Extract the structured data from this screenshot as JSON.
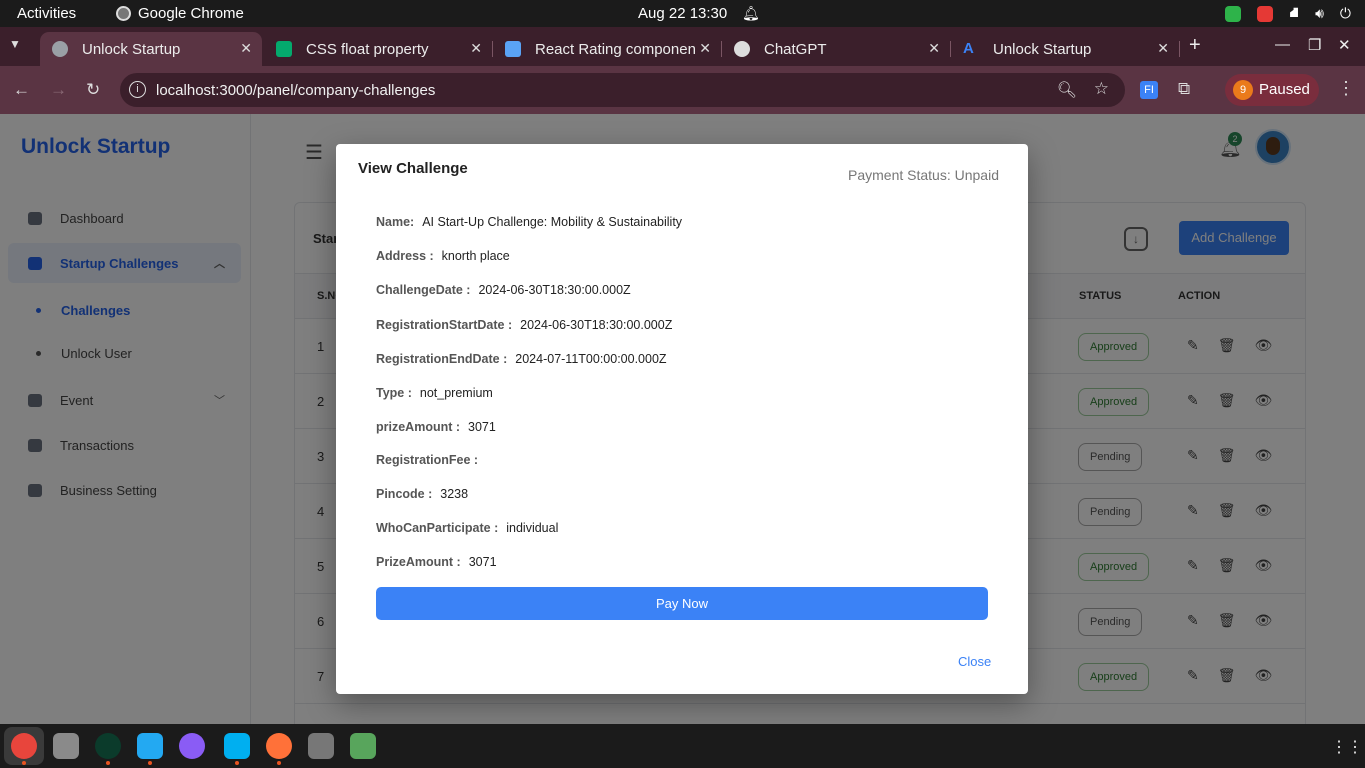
{
  "system": {
    "activities": "Activities",
    "app_name": "Google Chrome",
    "clock": "Aug 22  13:30"
  },
  "browser": {
    "tabs": [
      {
        "title": "Unlock Startup",
        "favicon": "globe-icon",
        "color": "#9aa0a6"
      },
      {
        "title": "CSS float property",
        "favicon": "w3schools-icon",
        "color": "#04aa6d"
      },
      {
        "title": "React Rating componen",
        "favicon": "mui-icon",
        "color": "#5aa3f5"
      },
      {
        "title": "ChatGPT",
        "favicon": "openai-icon",
        "color": "#dddddd"
      },
      {
        "title": "Unlock Startup",
        "favicon": "a-logo-icon",
        "color": "#3b82f6"
      }
    ],
    "url": "localhost:3000/panel/company-challenges",
    "profile_initial": "9",
    "profile_status": "Paused",
    "extension_label": "FI"
  },
  "app": {
    "brand": "Unlock Startup",
    "sidebar": {
      "items": [
        {
          "label": "Dashboard",
          "icon": "dashboard-icon"
        },
        {
          "label": "Startup Challenges",
          "icon": "challenges-icon",
          "expanded": true
        },
        {
          "label": "Event",
          "icon": "calendar-icon"
        },
        {
          "label": "Transactions",
          "icon": "wallet-icon"
        },
        {
          "label": "Business Setting",
          "icon": "settings-icon"
        }
      ],
      "sub_items": [
        {
          "label": "Challenges",
          "active": true
        },
        {
          "label": "Unlock User",
          "active": false
        }
      ]
    },
    "notification_count": "2",
    "card_title": "Star",
    "add_button": "Add Challenge",
    "table": {
      "headers": [
        "S.NO",
        "STATUS",
        "ACTION"
      ],
      "rows": [
        {
          "sn": "1",
          "status": "Approved"
        },
        {
          "sn": "2",
          "status": "Approved"
        },
        {
          "sn": "3",
          "status": "Pending"
        },
        {
          "sn": "4",
          "status": "Pending"
        },
        {
          "sn": "5",
          "status": "Approved"
        },
        {
          "sn": "6",
          "status": "Pending"
        },
        {
          "sn": "7",
          "status": "Approved"
        }
      ]
    }
  },
  "modal": {
    "title": "View Challenge",
    "payment_status_label": "Payment Status:",
    "payment_status_value": "Unpaid",
    "fields": [
      {
        "label": "Name:",
        "value": "AI Start-Up Challenge: Mobility & Sustainability"
      },
      {
        "label": "Address :",
        "value": "knorth place"
      },
      {
        "label": "ChallengeDate :",
        "value": "2024-06-30T18:30:00.000Z"
      },
      {
        "label": "RegistrationStartDate :",
        "value": "2024-06-30T18:30:00.000Z"
      },
      {
        "label": "RegistrationEndDate :",
        "value": "2024-07-11T00:00:00.000Z"
      },
      {
        "label": "Type :",
        "value": "not_premium"
      },
      {
        "label": "prizeAmount :",
        "value": "3071"
      },
      {
        "label": "RegistrationFee :",
        "value": ""
      },
      {
        "label": "Pincode :",
        "value": "3238"
      },
      {
        "label": "WhoCanParticipate :",
        "value": "individual"
      },
      {
        "label": "PrizeAmount :",
        "value": "3071"
      }
    ],
    "pay_button": "Pay Now",
    "close_button": "Close"
  },
  "dock": [
    {
      "name": "chrome-icon",
      "color": "#e8453c"
    },
    {
      "name": "files-icon",
      "color": "#8a8a8a"
    },
    {
      "name": "mongodb-compass-icon",
      "color": "#00ed64"
    },
    {
      "name": "vscode-icon",
      "color": "#23a9f2"
    },
    {
      "name": "github-desktop-icon",
      "color": "#8a5cf5"
    },
    {
      "name": "skype-icon",
      "color": "#00aff0"
    },
    {
      "name": "firefox-icon",
      "color": "#ff7139"
    },
    {
      "name": "text-editor-icon",
      "color": "#777777"
    },
    {
      "name": "trash-icon",
      "color": "#58a55c"
    }
  ]
}
